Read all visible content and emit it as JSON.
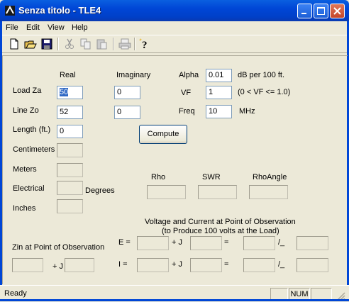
{
  "window": {
    "title": "Senza titolo - TLE4"
  },
  "menu": [
    "File",
    "Edit",
    "View",
    "Help"
  ],
  "toolbar": [
    "new-icon",
    "open-icon",
    "save-icon",
    "cut-icon",
    "copy-icon",
    "paste-icon",
    "print-icon",
    "help-icon"
  ],
  "headers": {
    "real": "Real",
    "imaginary": "Imaginary"
  },
  "load": {
    "label": "Load Za",
    "real": "50",
    "imag": "0"
  },
  "line": {
    "label": "Line Zo",
    "real": "52",
    "imag": "0"
  },
  "length": {
    "label": "Length (ft.)",
    "value": "0"
  },
  "alpha": {
    "label": "Alpha",
    "value": "0.01",
    "unit": "dB per 100 ft."
  },
  "vf": {
    "label": "VF",
    "value": "1",
    "unit": "(0 < VF <= 1.0)"
  },
  "freq": {
    "label": "Freq",
    "value": "10",
    "unit": "MHz"
  },
  "compute_label": "Compute",
  "outputs": {
    "centimeters": "Centimeters",
    "meters": "Meters",
    "electrical": "Electrical",
    "degrees": "Degrees",
    "inches": "Inches"
  },
  "results": {
    "rho": "Rho",
    "swr": "SWR",
    "rhoangle": "RhoAngle"
  },
  "observation": {
    "title1": "Voltage and Current at Point of Observation",
    "title2": "(to Produce 100 volts at the Load)",
    "zin": "Zin at Point of Observation",
    "e": "E =",
    "i": "I =",
    "j": "+ J",
    "eq": "=",
    "angle": "/_"
  },
  "status": {
    "text": "Ready",
    "num": "NUM"
  }
}
